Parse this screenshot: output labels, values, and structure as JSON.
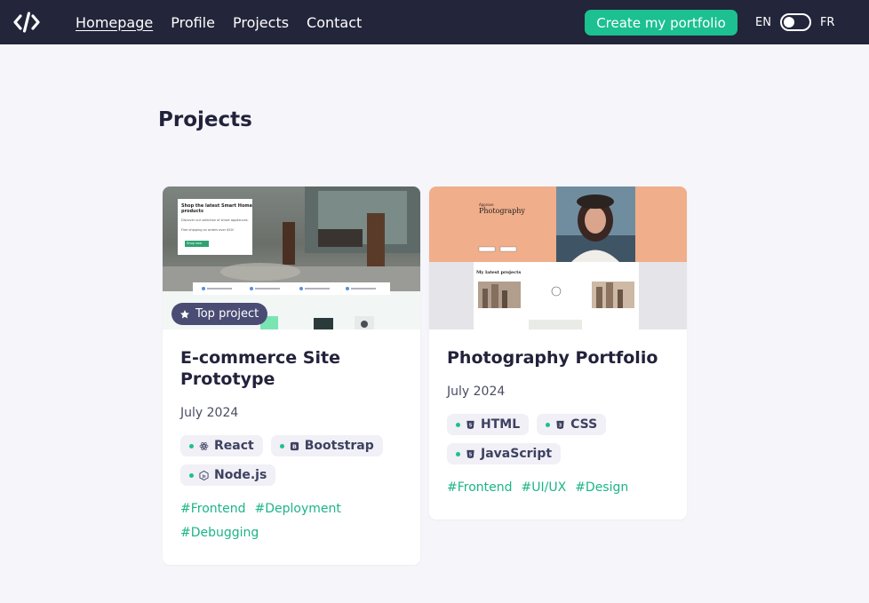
{
  "nav": {
    "logo_icon": "code-icon",
    "links": [
      {
        "label": "Homepage",
        "active": true
      },
      {
        "label": "Profile"
      },
      {
        "label": "Projects"
      },
      {
        "label": "Contact"
      }
    ],
    "cta_label": "Create my portfolio",
    "lang_left": "EN",
    "lang_right": "FR"
  },
  "page": {
    "title": "Projects"
  },
  "projects": [
    {
      "title": "E-commerce Site Prototype",
      "date": "July 2024",
      "badge": "Top project",
      "badge_icon": "star-icon",
      "thumb": {
        "headline": "Shop the latest Smart Home products",
        "line1": "Discover our selection of smart appliances.",
        "line2": "Free shipping on orders over $50!",
        "button": "Shop now"
      },
      "techs": [
        {
          "name": "React",
          "icon": "react-icon"
        },
        {
          "name": "Bootstrap",
          "icon": "bootstrap-icon"
        },
        {
          "name": "Node.js",
          "icon": "nodejs-icon"
        }
      ],
      "hashtags": [
        "#Frontend",
        "#Deployment",
        "#Debugging"
      ]
    },
    {
      "title": "Photography Portfolio",
      "date": "July 2024",
      "thumb": {
        "pretitle": "Approve",
        "title": "Photography",
        "section": "My latest projects"
      },
      "techs": [
        {
          "name": "HTML",
          "icon": "html5-icon"
        },
        {
          "name": "CSS",
          "icon": "css3-icon"
        },
        {
          "name": "JavaScript",
          "icon": "js-icon"
        }
      ],
      "hashtags": [
        "#Frontend",
        "#UI/UX",
        "#Design"
      ]
    }
  ],
  "colors": {
    "nav_bg": "#23253a",
    "accent": "#1cc091",
    "badge_bg": "#4a4c74",
    "page_bg": "#f5f5fa"
  }
}
